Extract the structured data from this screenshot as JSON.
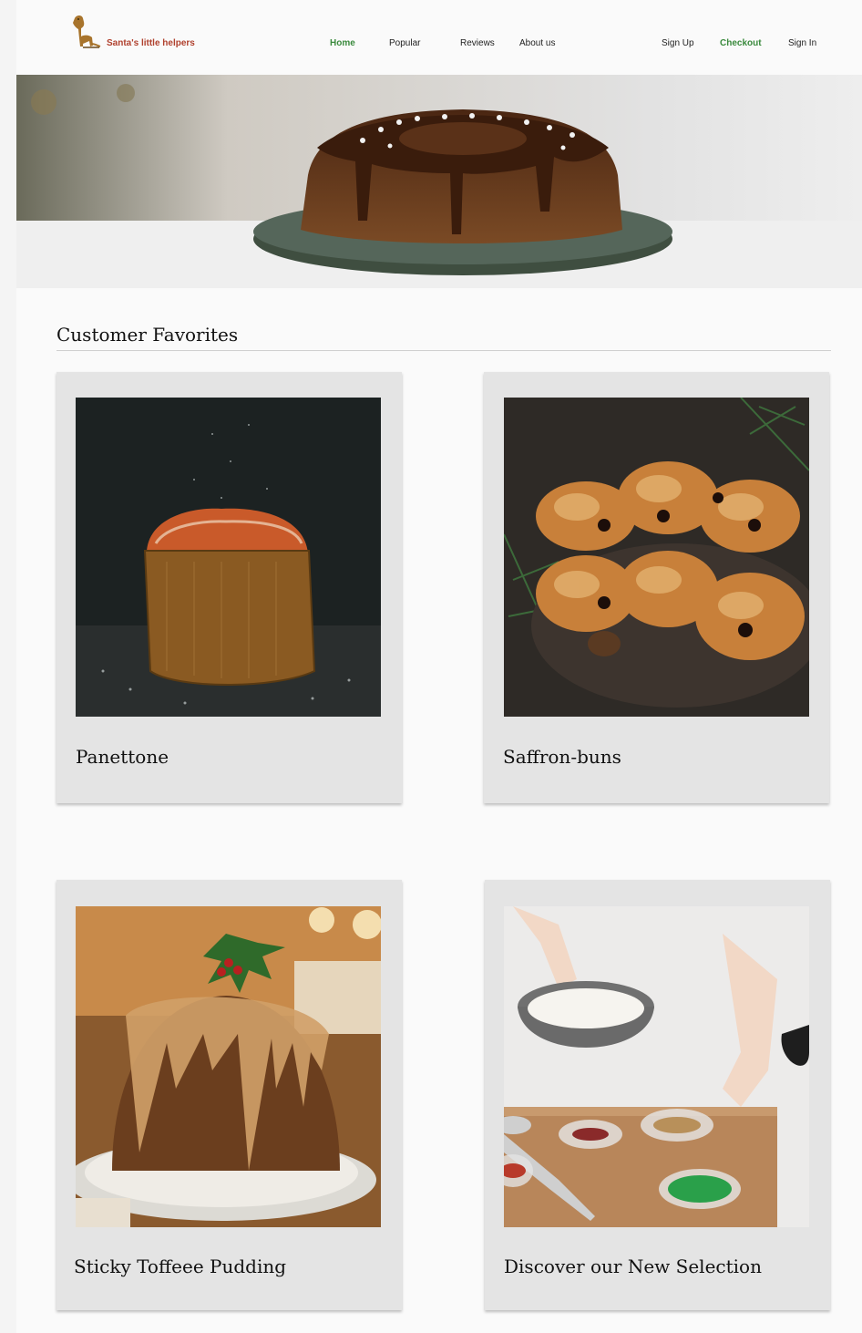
{
  "brand": {
    "name": "Santa's little helpers",
    "logo_icon": "dog-icon"
  },
  "nav": {
    "home": "Home",
    "popular": "Popular",
    "reviews": "Reviews",
    "about": "About us",
    "active": "Home"
  },
  "auth": {
    "signup": "Sign Up",
    "checkout": "Checkout",
    "signin": "Sign In"
  },
  "hero": {
    "image": "chocolate-bundt-cake-photo"
  },
  "favorites": {
    "title": "Customer Favorites",
    "items": [
      {
        "label": "Panettone",
        "image": "panettone-photo"
      },
      {
        "label": "Saffron-buns",
        "image": "saffron-buns-photo"
      },
      {
        "label": "Sticky Toffeee Pudding",
        "image": "sticky-toffee-pudding-photo"
      },
      {
        "label": "Discover our New Selection",
        "image": "baking-ingredients-photo"
      }
    ]
  },
  "colors": {
    "accent_green": "#3a8a3d",
    "brand_red": "#b0412e",
    "card_bg": "#e4e4e4"
  }
}
